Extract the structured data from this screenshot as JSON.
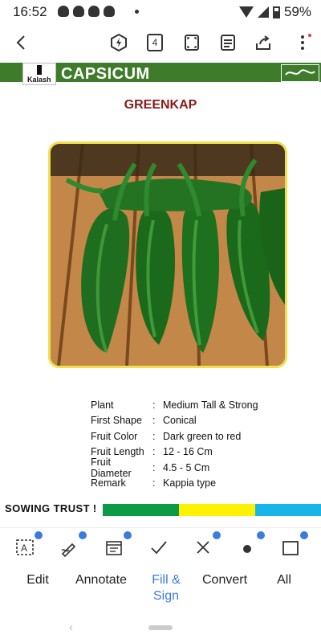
{
  "status_bar": {
    "time": "16:52",
    "battery": "59%"
  },
  "document": {
    "header_title": "CAPSICUM",
    "logo_text": "Kalash",
    "product_name": "GREENKAP",
    "specs": [
      {
        "key": "Plant",
        "value": "Medium Tall & Strong"
      },
      {
        "key": "First Shape",
        "value": "Conical"
      },
      {
        "key": "Fruit Color",
        "value": "Dark green to red"
      },
      {
        "key": "Fruit Length",
        "value": "12 - 16 Cm"
      },
      {
        "key": "Fruit Diameter",
        "value": "4.5 - 5 Cm"
      },
      {
        "key": "Remark",
        "value": "Kappia type"
      }
    ],
    "footer_slogan": "SOWING TRUST !",
    "colors": {
      "header_green": "#3e7b2a",
      "product_red": "#8b1a1a",
      "band_green": "#0d9a47",
      "band_yellow": "#fff200",
      "band_blue": "#18b6e8"
    }
  },
  "toolbar": {
    "icons": [
      "back-arrow-icon",
      "flash-icon",
      "page-count-icon",
      "fit-page-icon",
      "reader-mode-icon",
      "share-icon",
      "more-icon"
    ],
    "page_count": "4"
  },
  "tools": [
    "text-box-tool",
    "signature-tool",
    "date-tool",
    "checkmark-tool",
    "cross-tool",
    "dot-tool",
    "rectangle-tool"
  ],
  "tabs": [
    {
      "label": "Edit"
    },
    {
      "label": "Annotate"
    },
    {
      "label": "Fill & Sign",
      "active": true
    },
    {
      "label": "Convert"
    },
    {
      "label": "All"
    }
  ]
}
